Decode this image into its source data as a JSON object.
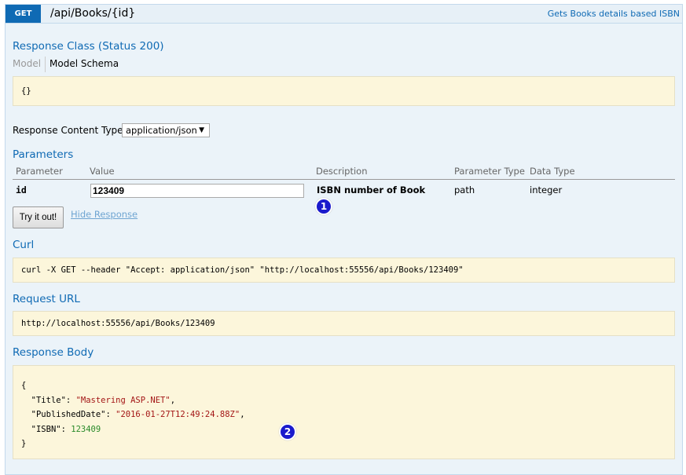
{
  "operation": {
    "method": "GET",
    "path": "/api/Books/{id}",
    "summary": "Gets Books details based ISBN"
  },
  "response_class": {
    "title": "Response Class (Status 200)",
    "tab_model": "Model",
    "tab_schema": "Model Schema",
    "schema": "{}"
  },
  "content_type": {
    "label": "Response Content Type",
    "value": "application/json"
  },
  "parameters": {
    "title": "Parameters",
    "headers": [
      "Parameter",
      "Value",
      "Description",
      "Parameter Type",
      "Data Type"
    ],
    "rows": [
      {
        "name": "id",
        "value": "123409",
        "description": "ISBN number of Book",
        "param_type": "path",
        "data_type": "integer"
      }
    ]
  },
  "actions": {
    "try": "Try it out!",
    "hide": "Hide Response"
  },
  "callouts": [
    "1",
    "2"
  ],
  "curl": {
    "title": "Curl",
    "value": "curl -X GET --header \"Accept: application/json\" \"http://localhost:55556/api/Books/123409\""
  },
  "request_url": {
    "title": "Request URL",
    "value": "http://localhost:55556/api/Books/123409"
  },
  "response_body": {
    "title": "Response Body",
    "open": "{",
    "close": "}",
    "fields": [
      {
        "key": "\"Title\"",
        "value": "\"Mastering ASP.NET\"",
        "sep": ","
      },
      {
        "key": "\"PublishedDate\"",
        "value": "\"2016-01-27T12:49:24.88Z\"",
        "sep": ","
      },
      {
        "key": "\"ISBN\"",
        "value": "123409",
        "sep": ""
      }
    ]
  }
}
